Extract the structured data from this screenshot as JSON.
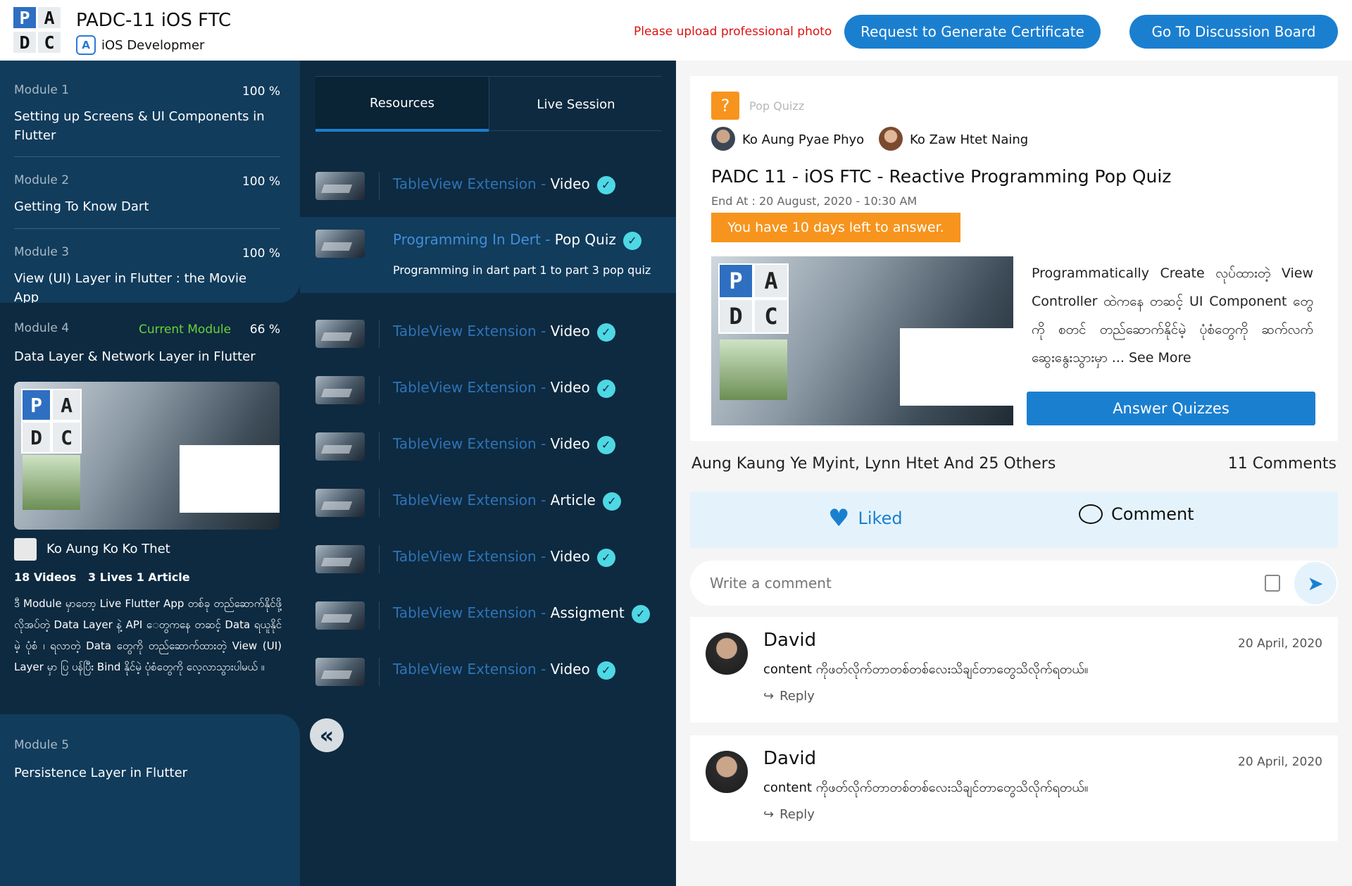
{
  "header": {
    "logo": [
      "P",
      "A",
      "D",
      "C"
    ],
    "title": "PADC-11 iOS FTC",
    "subtitle": "iOS Developmer",
    "warning": "Please upload professional photo",
    "btn_certificate": "Request to Generate Certificate",
    "btn_discussion": "Go To Discussion Board"
  },
  "modules": [
    {
      "label": "Module 1",
      "pct": "100 %",
      "title": "Setting up Screens & UI Components in Flutter"
    },
    {
      "label": "Module 2",
      "pct": "100 %",
      "title": "Getting To Know Dart"
    },
    {
      "label": "Module 3",
      "pct": "100 %",
      "title": "View (UI) Layer in Flutter : the Movie App"
    },
    {
      "label": "Module 4",
      "status": "Current Module",
      "pct": "66 %",
      "title": "Data Layer & Network Layer in Flutter",
      "instructor": "Ko Aung Ko Ko Thet",
      "stats": "18 Videos   3 Lives 1 Article",
      "desc": "ဒီ Module မှာတော့ Live Flutter App တစ်ခု တည်ဆောက်နိုင်ဖို့ လိုအပ်တဲ့ Data Layer နဲ့ API ေတွကနေ တဆင့် Data ရယူနိုင်မဲ့ ပုံစံ ၊ ရလာတဲ့ Data တွေကို တည်ဆောက်ထားတဲ့ View (UI) Layer မှာ ပြ ပန်ပြီး Bind နိုင်မဲ့ ပုံစံတွေကို လေ့လာသွားပါမယ် ။"
    },
    {
      "label": "Module 5",
      "title": "Persistence Layer in Flutter"
    }
  ],
  "tabs": {
    "resources": "Resources",
    "live": "Live Session"
  },
  "resources": [
    {
      "name": "TableView Extension",
      "kind": "Video"
    },
    {
      "name": "Programming In Dert",
      "kind": "Pop Quiz",
      "desc": "Programming in dart part 1 to part 3 pop quiz"
    },
    {
      "name": "TableView Extension",
      "kind": "Video"
    },
    {
      "name": "TableView Extension",
      "kind": "Video"
    },
    {
      "name": "TableView Extension",
      "kind": "Video"
    },
    {
      "name": "TableView Extension",
      "kind": "Article"
    },
    {
      "name": "TableView Extension",
      "kind": "Video"
    },
    {
      "name": "TableView Extension",
      "kind": "Assigment"
    },
    {
      "name": "TableView Extension",
      "kind": "Video"
    }
  ],
  "quiz": {
    "tag": "Pop Quizz",
    "author1": "Ko Aung Pyae Phyo",
    "author2": "Ko Zaw Htet Naing",
    "title": "PADC 11 - iOS FTC - Reactive Programming Pop Quiz",
    "end": "End At : 20 August, 2020 - 10:30 AM",
    "days": "You have 10 days left to answer.",
    "desc": "Programmatically Create လုပ်ထားတဲ့ View Controller ထဲကနေ တဆင့် UI Component တွေကို စတင် တည်ဆောက်နိုင်မဲ့ ပုံစံတွေကို ဆက်လက်ဆွေးနွေးသွားမှာ ... See More",
    "answer": "Answer Quizzes"
  },
  "social": {
    "likes": "Aung Kaung Ye Myint, Lynn Htet And 25 Others",
    "comments": "11 Comments",
    "liked": "Liked",
    "comment": "Comment",
    "placeholder": "Write a comment"
  },
  "comments": [
    {
      "name": "David",
      "date": "20 April, 2020",
      "text": "content ကိုဖတ်လိုက်တာတစ်တစ်လေးသိချင်တာတွေသိလိုက်ရတယ်။",
      "reply": "Reply"
    },
    {
      "name": "David",
      "date": "20 April, 2020",
      "text": "content ကိုဖတ်လိုက်တာတစ်တစ်လေးသိချင်တာတွေသိလိုက်ရတယ်။",
      "reply": "Reply"
    }
  ],
  "colors": {
    "brand": "#1b7fd0",
    "navy": "#0d2a40",
    "module": "#113c5c",
    "accent": "#f7941d",
    "check": "#4ed8e4"
  }
}
